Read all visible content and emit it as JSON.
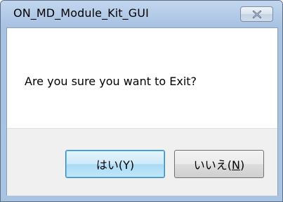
{
  "dialog": {
    "title": "ON_MD_Module_Kit_GUI",
    "message": "Are you sure you want to Exit?",
    "close_icon": "close-icon"
  },
  "buttons": {
    "yes_label": "はい(Y)",
    "no_label_prefix": "いいえ(",
    "no_label_mnemonic": "N",
    "no_label_suffix": ")"
  },
  "colors": {
    "title_bar": "#b3cbe8",
    "default_button_border": "#3c7fb1",
    "button_bar": "#f0f0f0"
  }
}
